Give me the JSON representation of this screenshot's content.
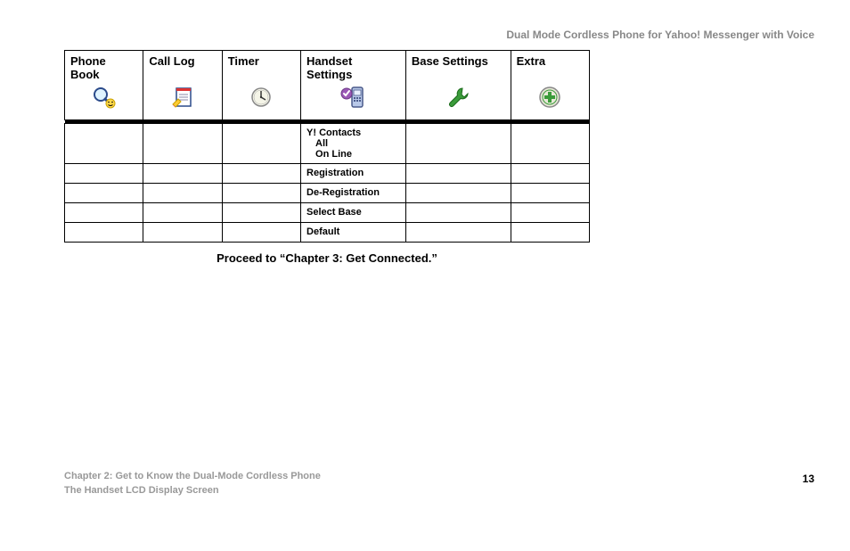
{
  "header": {
    "product_title": "Dual Mode Cordless Phone for Yahoo! Messenger with Voice"
  },
  "menu": {
    "columns": [
      {
        "label": "Phone Book"
      },
      {
        "label": "Call Log"
      },
      {
        "label": "Timer"
      },
      {
        "label": "Handset Settings"
      },
      {
        "label": "Base Settings"
      },
      {
        "label": "Extra"
      }
    ],
    "rows": [
      {
        "handset_settings": {
          "line1": "Y! Contacts",
          "line2": "All",
          "line3": "On Line"
        }
      },
      {
        "handset_settings": "Registration"
      },
      {
        "handset_settings": "De-Registration"
      },
      {
        "handset_settings": "Select Base"
      },
      {
        "handset_settings": "Default"
      }
    ]
  },
  "proceed_text": "Proceed to “Chapter 3: Get Connected.”",
  "footer": {
    "chapter": "Chapter 2: Get to Know the Dual-Mode Cordless Phone",
    "section": "The Handset LCD Display Screen",
    "page": "13"
  }
}
